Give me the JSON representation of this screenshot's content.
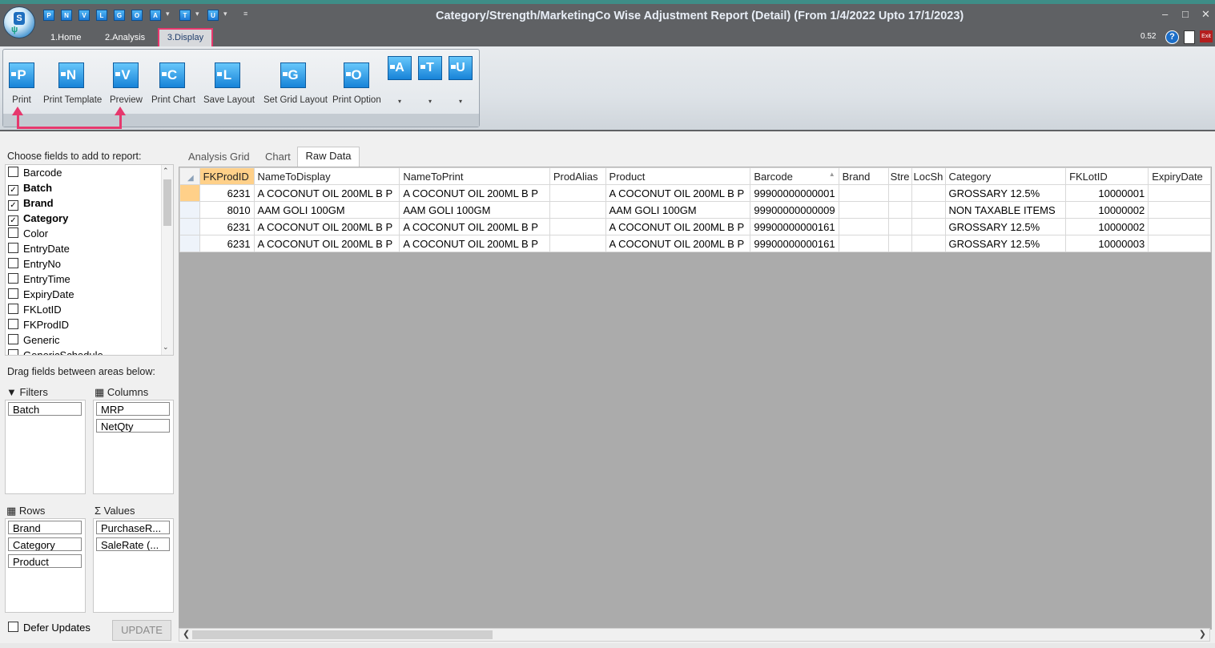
{
  "window": {
    "title": "Category/Strength/MarketingCo Wise Adjustment Report (Detail)  (From 1/4/2022 Upto 17/1/2023)",
    "minimize": "–",
    "maximize": "□",
    "close": "✕"
  },
  "quick_access": [
    "P",
    "N",
    "V",
    "L",
    "G",
    "O",
    "A",
    "T",
    "U"
  ],
  "ribbon_tabs": {
    "home": "1.Home",
    "analysis": "2.Analysis",
    "display": "3.Display"
  },
  "status": {
    "version": "0.52",
    "help": "?",
    "exit": "Exit"
  },
  "ribbon_buttons": [
    {
      "letter": "P",
      "label": "Print"
    },
    {
      "letter": "N",
      "label": "Print Template"
    },
    {
      "letter": "V",
      "label": "Preview"
    },
    {
      "letter": "C",
      "label": "Print Chart"
    },
    {
      "letter": "L",
      "label": "Save Layout"
    },
    {
      "letter": "G",
      "label": "Set Grid Layout"
    },
    {
      "letter": "O",
      "label": "Print Option"
    }
  ],
  "ribbon_small_buttons": [
    {
      "letter": "A"
    },
    {
      "letter": "T"
    },
    {
      "letter": "U"
    }
  ],
  "field_panel": {
    "choose_label": "Choose fields to add to report:",
    "fields": [
      {
        "name": "Barcode",
        "checked": false
      },
      {
        "name": "Batch",
        "checked": true
      },
      {
        "name": "Brand",
        "checked": true
      },
      {
        "name": "Category",
        "checked": true
      },
      {
        "name": "Color",
        "checked": false
      },
      {
        "name": "EntryDate",
        "checked": false
      },
      {
        "name": "EntryNo",
        "checked": false
      },
      {
        "name": "EntryTime",
        "checked": false
      },
      {
        "name": "ExpiryDate",
        "checked": false
      },
      {
        "name": "FKLotID",
        "checked": false
      },
      {
        "name": "FKProdID",
        "checked": false
      },
      {
        "name": "Generic",
        "checked": false
      },
      {
        "name": "GenericSchedule",
        "checked": false
      }
    ],
    "drag_label": "Drag fields between areas below:",
    "filters": {
      "title": "Filters",
      "items": [
        "Batch"
      ]
    },
    "columns": {
      "title": "Columns",
      "items": [
        "MRP",
        "NetQty"
      ]
    },
    "rows": {
      "title": "Rows",
      "items": [
        "Brand",
        "Category",
        "Product"
      ]
    },
    "values": {
      "title": "Values",
      "items": [
        "PurchaseR...",
        "SaleRate (..."
      ]
    },
    "defer_label": "Defer Updates",
    "update_label": "UPDATE"
  },
  "doc_tabs": {
    "analysis_grid": "Analysis Grid",
    "chart": "Chart",
    "raw_data": "Raw Data"
  },
  "grid": {
    "columns": [
      "FKProdID",
      "NameToDisplay",
      "NameToPrint",
      "ProdAlias",
      "Product",
      "Barcode",
      "Brand",
      "Stre",
      "LocSh",
      "Category",
      "FKLotID",
      "ExpiryDate"
    ],
    "rows": [
      [
        "6231",
        "A COCONUT OIL 200ML B P",
        "A COCONUT OIL 200ML B P",
        "",
        "A COCONUT OIL 200ML B P",
        "99900000000001",
        "",
        "",
        "",
        "GROSSARY 12.5%",
        "10000001",
        ""
      ],
      [
        "8010",
        "AAM GOLI 100GM",
        "AAM GOLI 100GM",
        "",
        "AAM GOLI 100GM",
        "99900000000009",
        "",
        "",
        "",
        "NON TAXABLE ITEMS",
        "10000002",
        ""
      ],
      [
        "6231",
        "A COCONUT OIL 200ML B P",
        "A COCONUT OIL 200ML B P",
        "",
        "A COCONUT OIL 200ML B P",
        "99900000000161",
        "",
        "",
        "",
        "GROSSARY 12.5%",
        "10000002",
        ""
      ],
      [
        "6231",
        "A COCONUT OIL 200ML B P",
        "A COCONUT OIL 200ML B P",
        "",
        "A COCONUT OIL 200ML B P",
        "99900000000161",
        "",
        "",
        "",
        "GROSSARY 12.5%",
        "10000003",
        ""
      ]
    ]
  },
  "colors": {
    "annotation": "#e6386d",
    "ribbon_icon": "#1783d8",
    "titlebar": "#5f6164",
    "selected_header": "#ffd089"
  }
}
